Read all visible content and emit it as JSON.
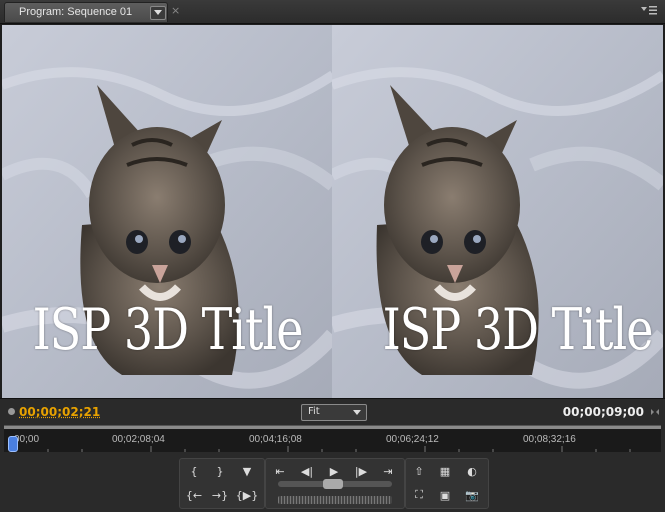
{
  "tab": {
    "title": "Program: Sequence 01",
    "close": "×"
  },
  "viewer": {
    "title_overlay": "ISP 3D Title"
  },
  "timecode": {
    "current": "00;00;02;21",
    "duration": "00;00;09;00"
  },
  "zoom": {
    "selected": "Fit"
  },
  "ruler": {
    "labels": [
      "00;00",
      "00;02;08;04",
      "00;04;16;08",
      "00;06;24;12",
      "00;08;32;16"
    ]
  },
  "icons": {
    "mark_in": "{",
    "mark_out": "}",
    "marker": "▼",
    "step_back_marker": "⇤",
    "step_back": "◀|",
    "play": "▶",
    "step_fwd": "|▶",
    "step_fwd_marker": "⇥",
    "goto_in": "{←",
    "goto_out": "→}",
    "play_in_out": "{▶}",
    "lift_extract": "⇧",
    "safe_margins": "▦",
    "output": "◐",
    "trim_monitor": "⛶",
    "multi_cam": "▣",
    "export_frame": "📷"
  }
}
